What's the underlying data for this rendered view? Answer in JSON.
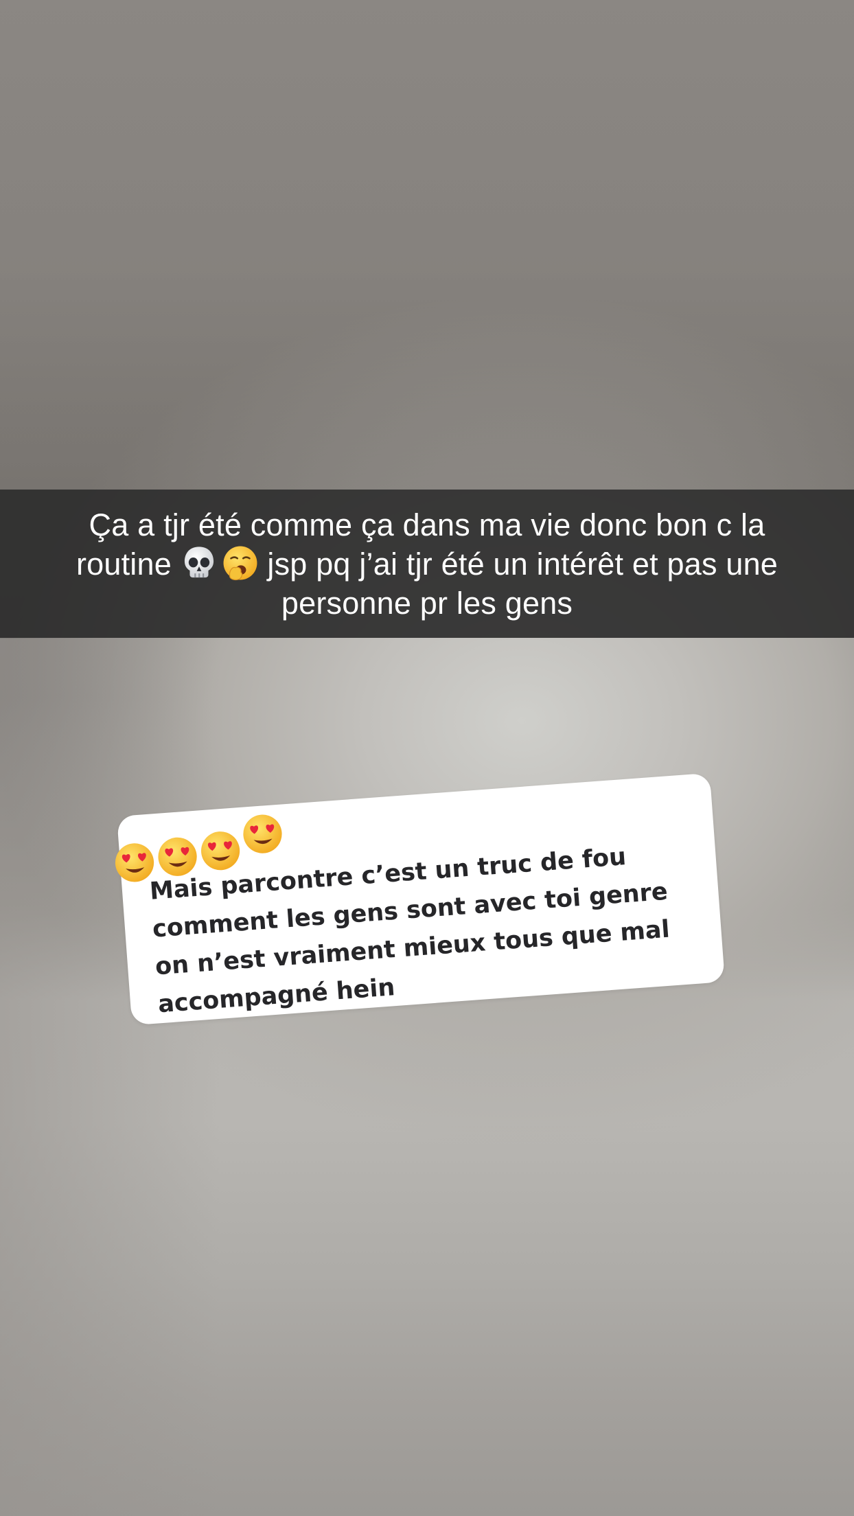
{
  "caption": {
    "text_line1": "Ça a tjr été comme ça dans ma vie donc bon c la",
    "text_line2_before": "routine ",
    "text_line2_after": " jsp pq j’ai tjr été un intérêt et pas une",
    "text_line3": "personne pr les gens",
    "emojis": [
      "skull-emoji",
      "yawning-face-emoji"
    ]
  },
  "reply_card": {
    "emojis": [
      "heart-eyes-emoji",
      "heart-eyes-emoji",
      "heart-eyes-emoji",
      "heart-eyes-emoji"
    ],
    "text": "Mais parcontre c’est un truc de fou comment les gens sont avec toi genre on n’est vraiment mieux tous que mal accompagné hein"
  },
  "colors": {
    "caption_bar": "#2a2a2a",
    "card_bg": "#ffffff",
    "card_text": "#262629"
  }
}
